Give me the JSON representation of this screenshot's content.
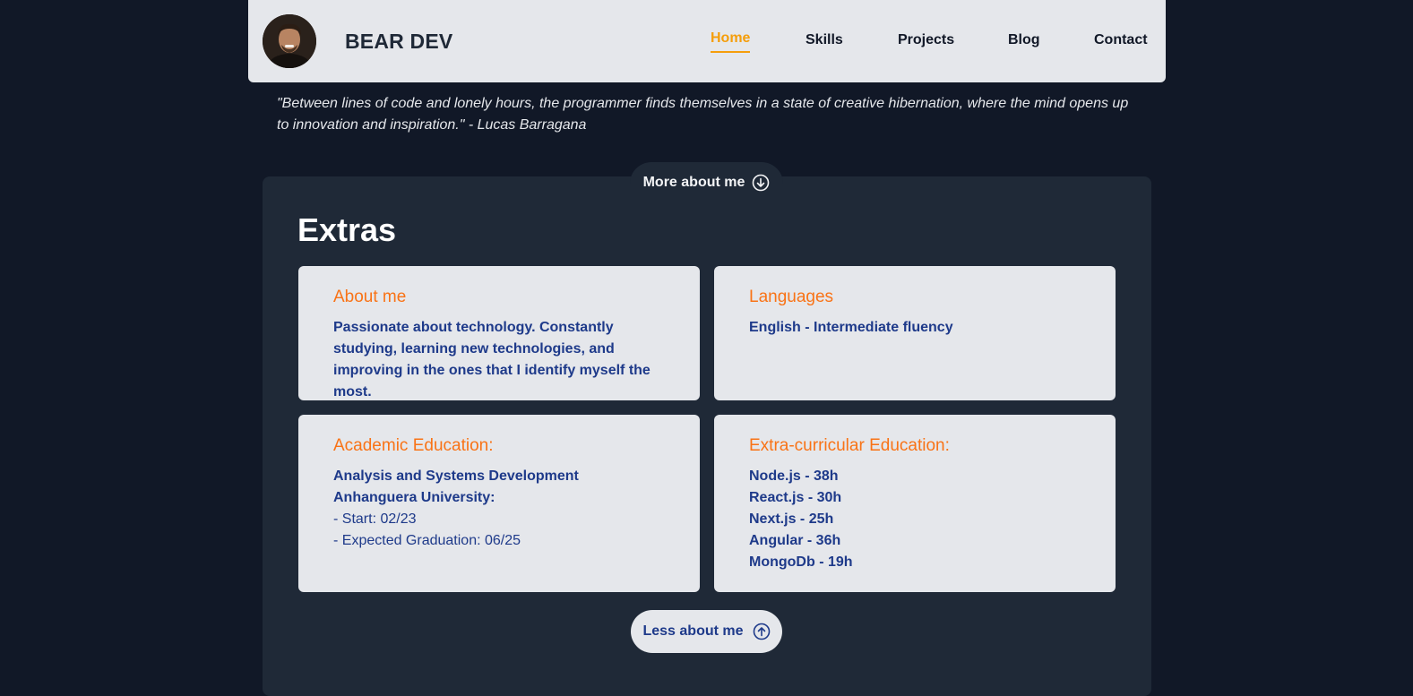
{
  "header": {
    "brand": "BEAR DEV",
    "nav": [
      {
        "label": "Home",
        "active": true
      },
      {
        "label": "Skills",
        "active": false
      },
      {
        "label": "Projects",
        "active": false
      },
      {
        "label": "Blog",
        "active": false
      },
      {
        "label": "Contact",
        "active": false
      }
    ]
  },
  "quote": "\"Between lines of code and lonely hours, the programmer finds themselves in a state of creative hibernation, where the mind opens up to innovation and inspiration.\" - Lucas Barragana",
  "more_about_label": "More about me",
  "extras": {
    "title": "Extras",
    "about": {
      "title": "About me",
      "text": "Passionate about technology. Constantly studying, learning new technologies, and improving in the ones that I identify myself the most."
    },
    "languages": {
      "title": "Languages",
      "text": "English - Intermediate fluency"
    },
    "academic": {
      "title": "Academic Education:",
      "course": "Analysis and Systems Development",
      "university": "Anhanguera University:",
      "start": "- Start: 02/23",
      "graduation": "- Expected Graduation: 06/25"
    },
    "extracurricular": {
      "title": "Extra-curricular Education:",
      "items": [
        "Node.js - 38h",
        "React.js - 30h",
        "Next.js - 25h",
        "Angular - 36h",
        "MongoDb - 19h"
      ]
    }
  },
  "less_about_label": "Less about me",
  "colors": {
    "page_bg": "#111827",
    "panel_bg": "#1f2937",
    "card_bg": "#e5e7eb",
    "accent_orange": "#f97316",
    "nav_active": "#f59e0b",
    "text_blue": "#1e3a8a"
  }
}
